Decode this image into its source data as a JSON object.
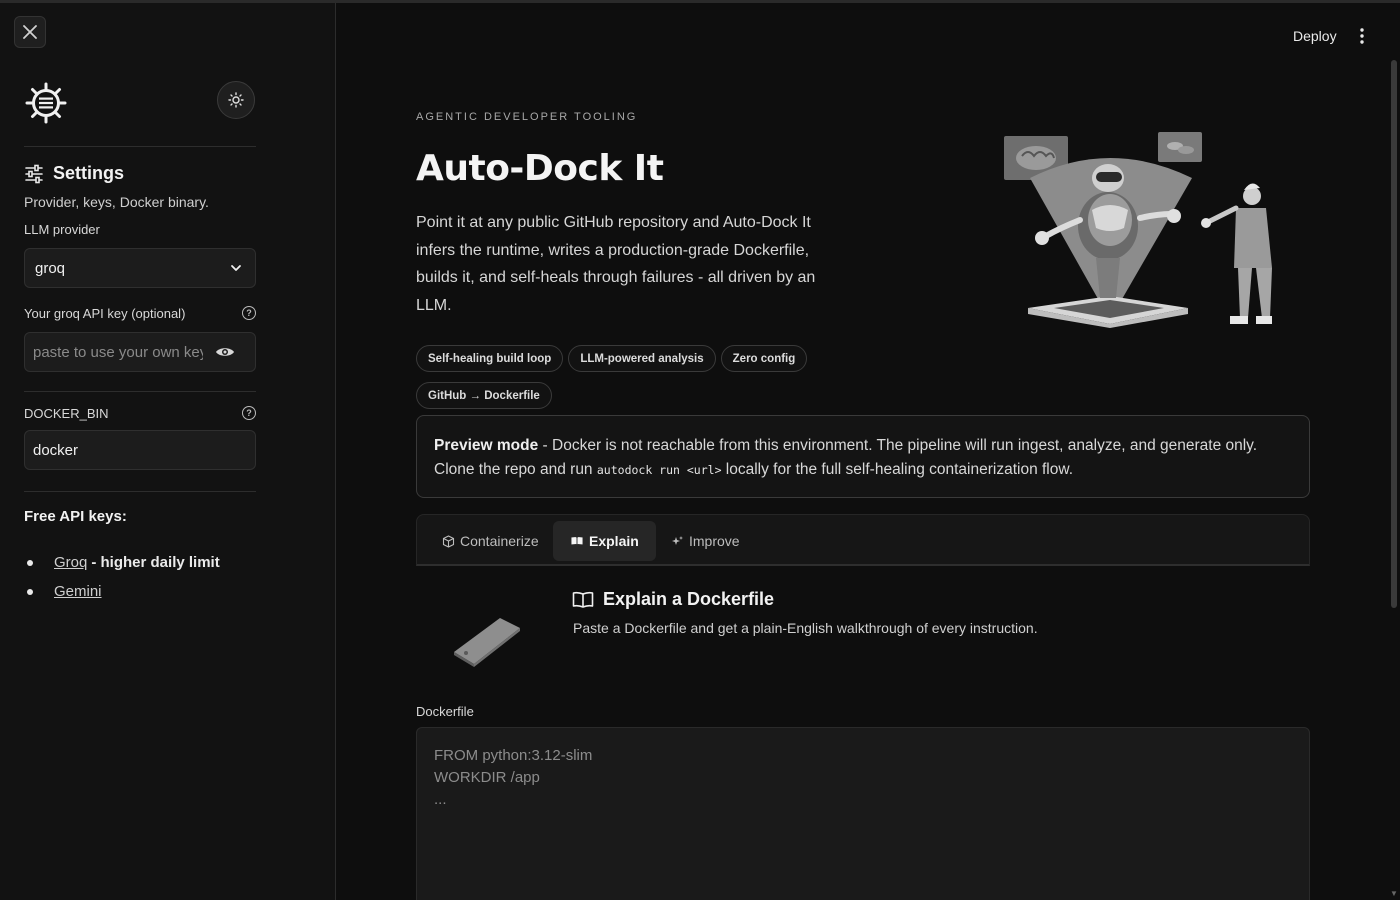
{
  "header": {
    "deploy_label": "Deploy"
  },
  "sidebar": {
    "settings_title": "Settings",
    "settings_subtitle": "Provider, keys, Docker binary.",
    "llm_provider_label": "LLM provider",
    "llm_provider_value": "groq",
    "api_key_label": "Your groq API key (optional)",
    "api_key_placeholder": "paste to use your own key",
    "docker_bin_label": "DOCKER_BIN",
    "docker_bin_value": "docker",
    "free_keys_title": "Free API keys:",
    "free_keys": [
      {
        "link": "Groq",
        "note": "- higher daily limit"
      },
      {
        "link": "Gemini",
        "note": ""
      }
    ]
  },
  "hero": {
    "eyebrow": "AGENTIC DEVELOPER TOOLING",
    "title": "Auto-Dock It",
    "description": "Point it at any public GitHub repository and Auto-Dock It infers the runtime, writes a production-grade Dockerfile, builds it, and self-heals through failures - all driven by an LLM.",
    "pills": [
      "Self-healing build loop",
      "LLM-powered analysis",
      "Zero config",
      "GitHub → Dockerfile"
    ]
  },
  "preview": {
    "label": "Preview mode",
    "text_before": " - Docker is not reachable from this environment. The pipeline will run ingest, analyze, and generate only. Clone the repo and run ",
    "code": "autodock run <url>",
    "text_after": " locally for the full self-healing containerization flow."
  },
  "tabs": [
    {
      "label": "Containerize",
      "icon": "box-icon"
    },
    {
      "label": "Explain",
      "icon": "book-icon"
    },
    {
      "label": "Improve",
      "icon": "sparkle-icon"
    }
  ],
  "explain": {
    "title": "Explain a Dockerfile",
    "subtitle": "Paste a Dockerfile and get a plain-English walkthrough of every instruction.",
    "dockerfile_label": "Dockerfile",
    "dockerfile_placeholder": "FROM python:3.12-slim\nWORKDIR /app\n..."
  }
}
